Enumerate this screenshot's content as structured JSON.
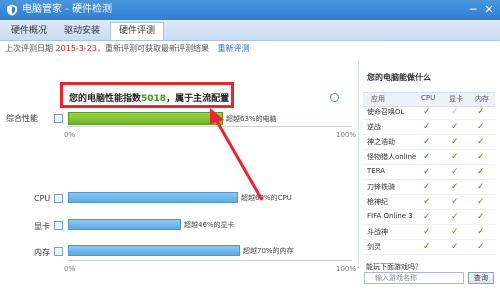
{
  "window": {
    "title": "电脑管家 - 硬件检测"
  },
  "tabs": [
    {
      "label": "硬件概况"
    },
    {
      "label": "驱动安装"
    },
    {
      "label": "硬件评测"
    }
  ],
  "info": {
    "prefix": "上次评测日期",
    "date": "2015-3-23",
    "suffix": "，重新评测可获取最新评测结果",
    "link": "重新评测"
  },
  "score": {
    "callout_prefix": "您的电脑性能指数",
    "value": "5018",
    "callout_suffix": "，属于主流配置",
    "label": "综合性能",
    "beat": "超越63%的电脑",
    "percent": 63
  },
  "axis": {
    "start": "0%",
    "end": "100%"
  },
  "components": [
    {
      "label": "CPU",
      "beat": "超越69%的CPU",
      "percent": 69
    },
    {
      "label": "显卡",
      "beat": "超越46%的显卡",
      "percent": 46
    },
    {
      "label": "内存",
      "beat": "超越70%的内存",
      "percent": 70
    }
  ],
  "sidebar": {
    "heading": "您的电脑能做什么",
    "columns": [
      "应用",
      "CPU",
      "显卡",
      "内存"
    ],
    "games": [
      {
        "name": "使命召唤OL",
        "cpu": "✓",
        "gpu": "✓",
        "mem": "✓"
      },
      {
        "name": "逆战",
        "cpu": "✓",
        "gpu": "✓",
        "mem": "✓"
      },
      {
        "name": "神之浩劫",
        "cpu": "✓",
        "gpu": "✓",
        "mem": "✓"
      },
      {
        "name": "怪物猎人online",
        "cpu": "✓",
        "gpu": "✓",
        "mem": "✓"
      },
      {
        "name": "TERA",
        "cpu": "✓",
        "gpu": "✓",
        "mem": "✓"
      },
      {
        "name": "刀锋铁骑",
        "cpu": "✓",
        "gpu": "✓",
        "mem": "✓"
      },
      {
        "name": "枪神纪",
        "cpu": "✓",
        "gpu": "✓",
        "mem": "✓"
      },
      {
        "name": "FIFA Online 3",
        "cpu": "✓",
        "gpu": "✓",
        "mem": "✓"
      },
      {
        "name": "斗战神",
        "cpu": "✓",
        "gpu": "✓",
        "mem": "✓"
      },
      {
        "name": "剑灵",
        "cpu": "✓",
        "gpu": "✓",
        "mem": "✓"
      }
    ],
    "question": "能玩下面游戏吗？",
    "search_placeholder": "输入游戏名称",
    "search_button": "查询"
  },
  "colors": {
    "titlebar": "#2f7fd0",
    "callout_border": "#e8262b",
    "green_bar": "#6cb62a",
    "blue_bar": "#5ea9e3",
    "check": "#3a9a1a"
  },
  "icons": [
    "shield-logo-icon",
    "minimize-icon",
    "close-icon",
    "magnify-icon",
    "checkmark-icon"
  ]
}
